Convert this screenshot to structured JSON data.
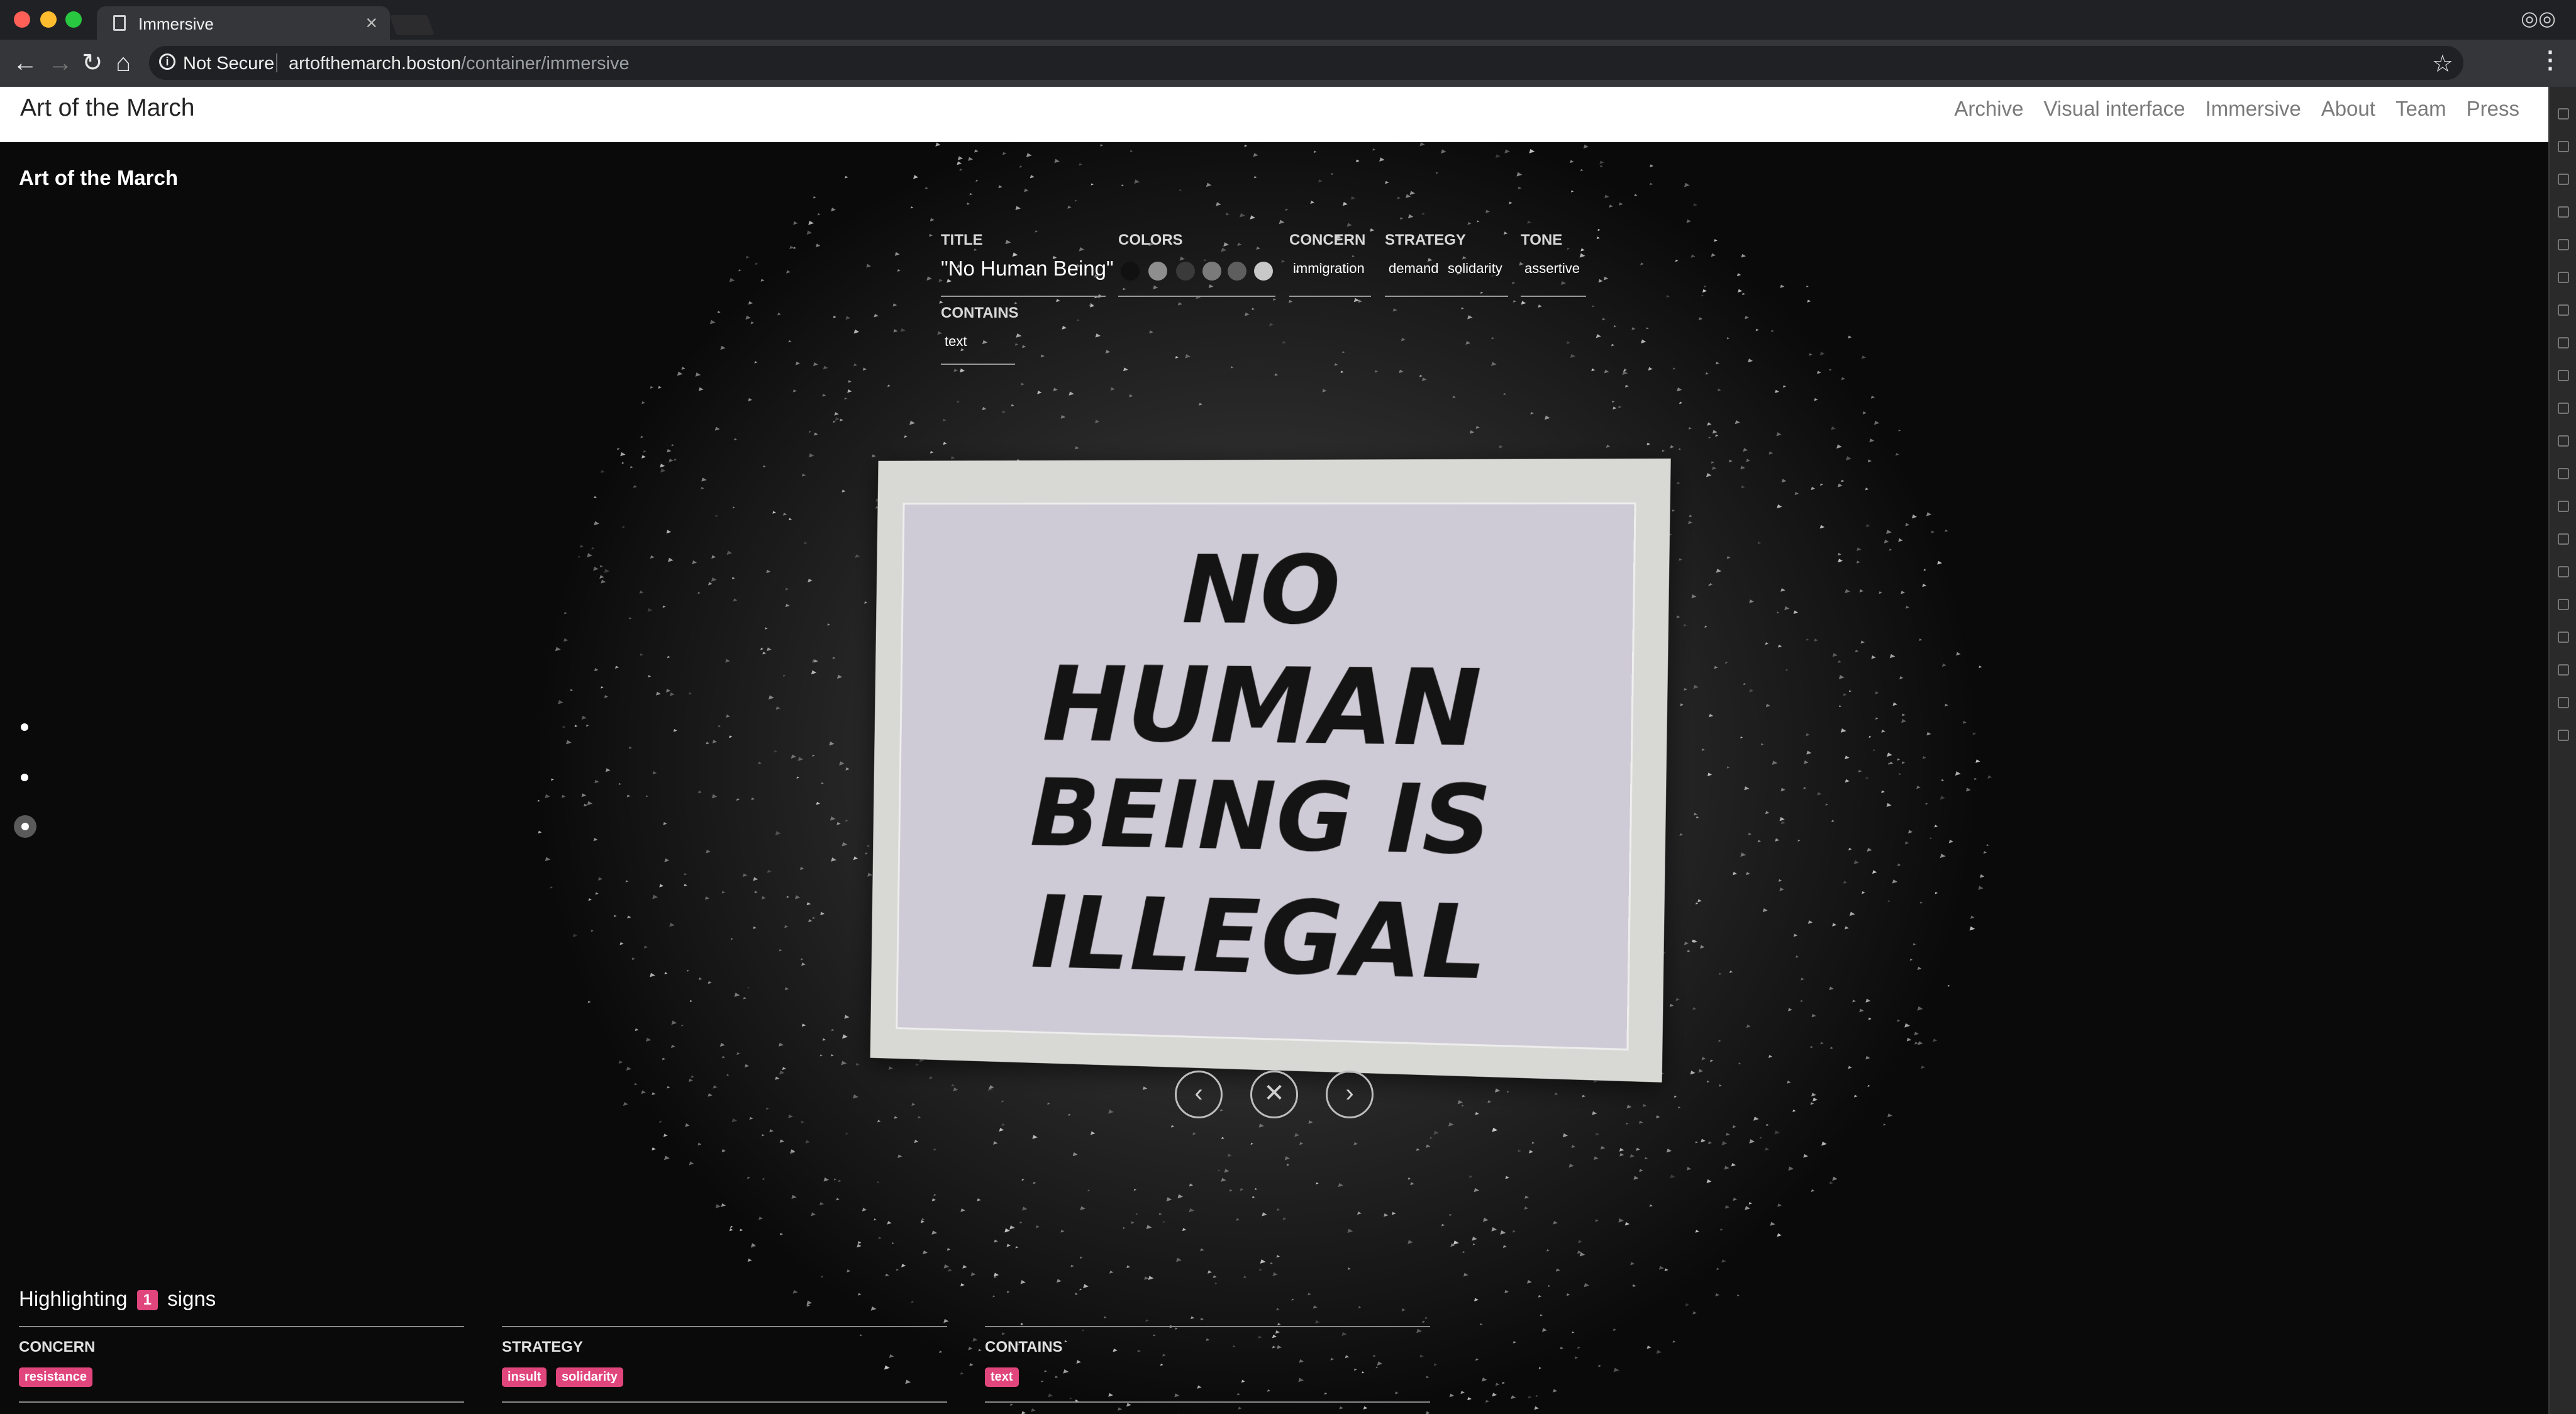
{
  "browser": {
    "tab_title": "Immersive",
    "security_label": "Not Secure",
    "url_host": "artofthemarch.boston",
    "url_path": "/container/immersive"
  },
  "site_nav": {
    "brand": "Art of the March",
    "links": [
      "Archive",
      "Visual interface",
      "Immersive",
      "About",
      "Team",
      "Press"
    ]
  },
  "scene": {
    "title": "Art of the March"
  },
  "sign_details": {
    "title_label": "TITLE",
    "title_value": "\"No Human Being\"",
    "colors_label": "COLORS",
    "colors": [
      "#111111",
      "#8e8e8e",
      "#3a3a3a",
      "#7a7a7a",
      "#5e5e5e",
      "#c8c8c8"
    ],
    "concern_label": "CONCERN",
    "concern_values": [
      "immigration"
    ],
    "strategy_label": "STRATEGY",
    "strategy_values": [
      "demand",
      "solidarity"
    ],
    "tone_label": "TONE",
    "tone_values": [
      "assertive"
    ],
    "contains_label": "CONTAINS",
    "contains_values": [
      "text"
    ]
  },
  "sign_image": {
    "lines": [
      "NO",
      "HUMAN",
      "BEING IS",
      "ILLEGAL"
    ]
  },
  "controls": {
    "prev_icon": "chevron-left-icon",
    "close_icon": "close-icon",
    "next_icon": "chevron-right-icon"
  },
  "highlight": {
    "prefix": "Highlighting",
    "count": "1",
    "suffix": "signs",
    "filters": [
      {
        "label": "CONCERN",
        "tags": [
          "resistance"
        ]
      },
      {
        "label": "STRATEGY",
        "tags": [
          "insult",
          "solidarity"
        ]
      },
      {
        "label": "CONTAINS",
        "tags": [
          "text"
        ]
      }
    ]
  }
}
